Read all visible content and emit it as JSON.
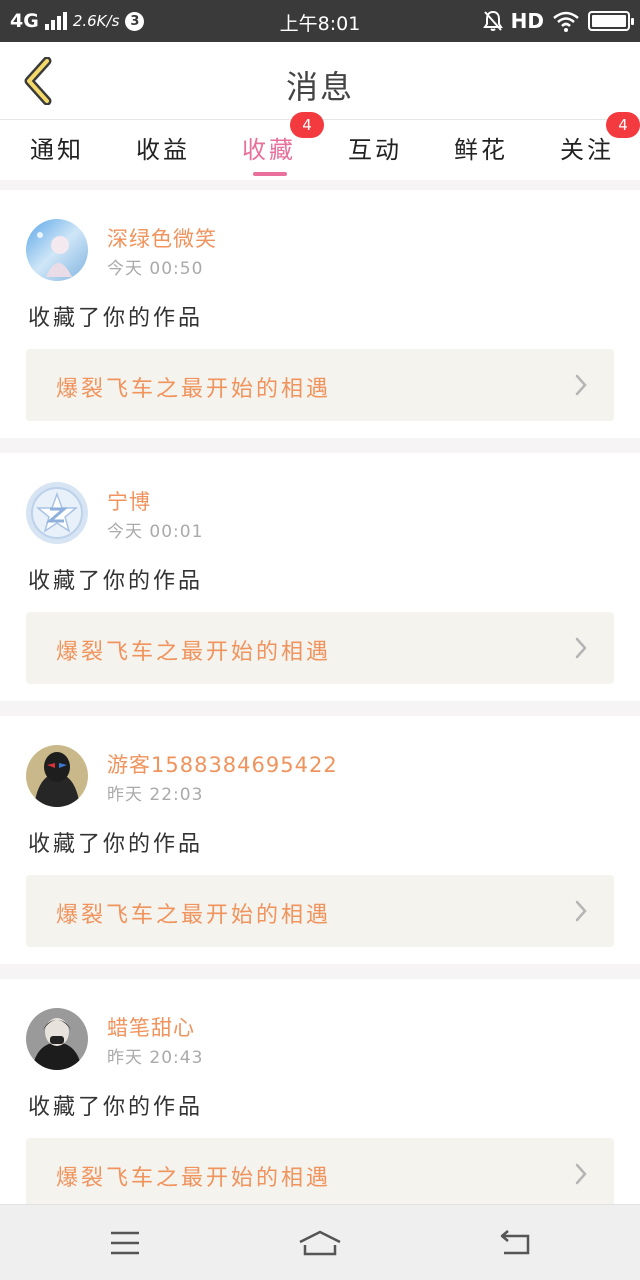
{
  "status_bar": {
    "network": "4G",
    "speed": "2.6K/s",
    "notif_count": "3",
    "time": "上午8:01",
    "hd": "HD"
  },
  "header": {
    "title": "消息",
    "back_icon": "chevron-left-icon"
  },
  "tabs": [
    {
      "label": "通知",
      "active": false,
      "badge": ""
    },
    {
      "label": "收益",
      "active": false,
      "badge": ""
    },
    {
      "label": "收藏",
      "active": true,
      "badge": "4"
    },
    {
      "label": "互动",
      "active": false,
      "badge": ""
    },
    {
      "label": "鲜花",
      "active": false,
      "badge": ""
    },
    {
      "label": "关注",
      "active": false,
      "badge": "4"
    }
  ],
  "messages": [
    {
      "user": "深绿色微笑",
      "time": "今天 00:50",
      "action": "收藏了你的作品",
      "work": "爆裂飞车之最开始的相遇"
    },
    {
      "user": "宁博",
      "time": "今天 00:01",
      "action": "收藏了你的作品",
      "work": "爆裂飞车之最开始的相遇"
    },
    {
      "user": "游客1588384695422",
      "time": "昨天 22:03",
      "action": "收藏了你的作品",
      "work": "爆裂飞车之最开始的相遇"
    },
    {
      "user": "蜡笔甜心",
      "time": "昨天 20:43",
      "action": "收藏了你的作品",
      "work": "爆裂飞车之最开始的相遇"
    }
  ],
  "colors": {
    "accent": "#e8709a",
    "name_orange": "#f0935c",
    "badge_red": "#f23a3f",
    "status_bar": "#3a3a3a"
  },
  "nav_icons": [
    "menu-icon",
    "home-icon",
    "back-icon"
  ]
}
